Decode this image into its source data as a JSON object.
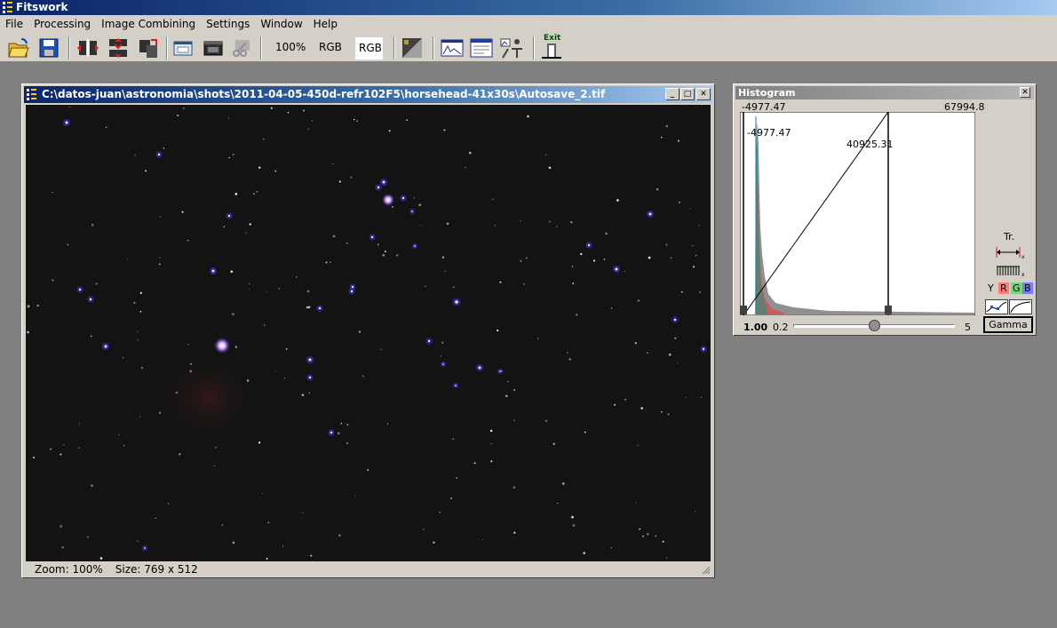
{
  "app": {
    "title": "Fitswork"
  },
  "menu": [
    "File",
    "Processing",
    "Image Combining",
    "Settings",
    "Window",
    "Help"
  ],
  "toolbar": {
    "zoom_label": "100%",
    "rgb_label": "RGB",
    "rgb_label_active": "RGB",
    "exit_label": "Exit"
  },
  "image_window": {
    "title": "C:\\datos-juan\\astronomia\\shots\\2011-04-05-450d-refr102F5\\horsehead-41x30s\\Autosave_2.tif",
    "zoom_text": "Zoom: 100%",
    "size_text": "Size: 769 x 512"
  },
  "histogram": {
    "title": "Histogram",
    "min_label": "-4977.47",
    "max_label": "67994.8",
    "black_point": "-4977.47",
    "white_point": "40925.31",
    "gamma_value": "1.00",
    "slider_min": "0.2",
    "slider_max": "5",
    "gamma_button": "Gamma",
    "tr_label": "Tr.",
    "channels": [
      "Y",
      "R",
      "G",
      "B"
    ],
    "channel_colors": {
      "R": "#ff7b7b",
      "G": "#7bd37b",
      "B": "#7b7bff"
    }
  },
  "colors": {
    "titlebar_start": "#0a246a",
    "titlebar_end": "#a6caf0",
    "workspace": "#808080",
    "chrome": "#d4d0c8"
  }
}
